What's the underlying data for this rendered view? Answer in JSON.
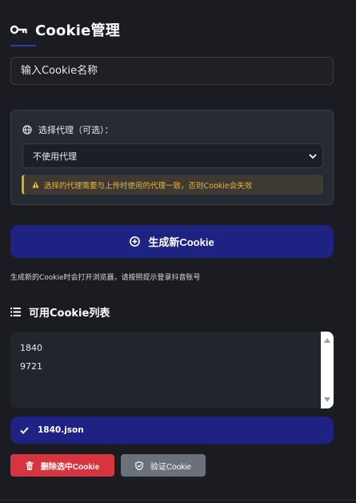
{
  "header": {
    "title": "Cookie管理",
    "icon": "key-icon"
  },
  "name_input": {
    "placeholder": "输入Cookie名称",
    "value": ""
  },
  "proxy": {
    "label": "选择代理（可选）：",
    "icon": "globe-icon",
    "selected": "不使用代理",
    "warning": "选择的代理需要与上传时使用的代理一致，否则Cookie会失效"
  },
  "generate": {
    "label": "生成新Cookie",
    "hint": "生成新的Cookie时会打开浏览器，请按照提示登录抖音账号"
  },
  "cookie_list": {
    "title": "可用Cookie列表",
    "items": [
      "1840",
      "9721"
    ]
  },
  "selected_file": "1840.json",
  "actions": {
    "delete_label": "删除选中Cookie",
    "verify_label": "验证Cookie"
  },
  "colors": {
    "background": "#1a1c22",
    "primary": "#1e2282",
    "danger": "#d7343f",
    "secondary": "#6b717a",
    "warning": "#f0b42c"
  }
}
